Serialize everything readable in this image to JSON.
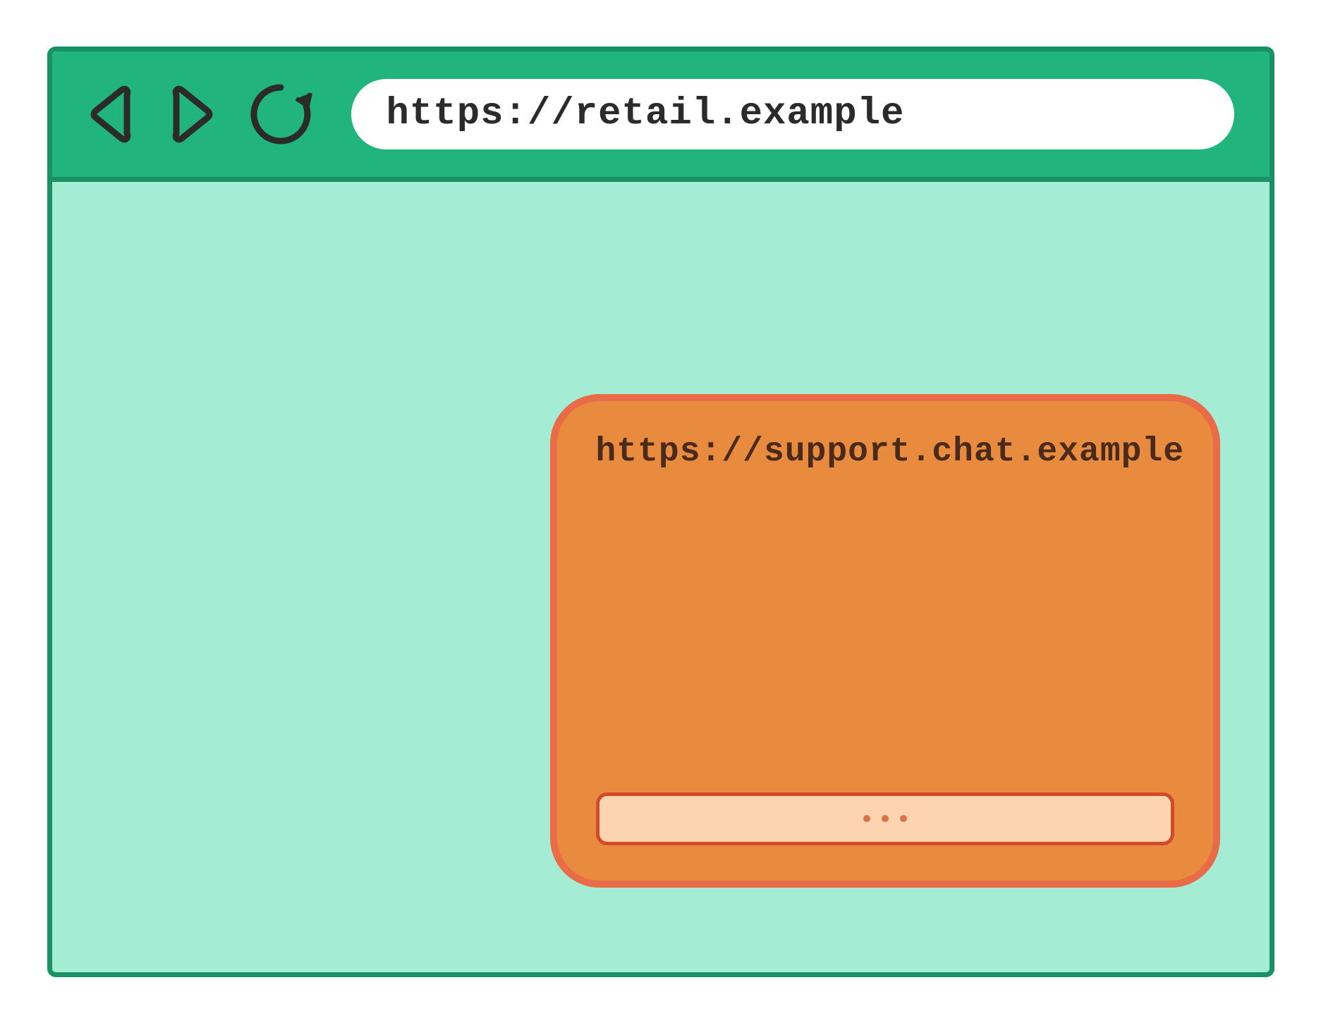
{
  "browser": {
    "url": "https://retail.example"
  },
  "chat_widget": {
    "url": "https://support.chat.example"
  },
  "colors": {
    "browser_border": "#1a9066",
    "toolbar_bg": "#21b47c",
    "content_bg": "#a4ecd4",
    "widget_bg": "#e98b3f",
    "widget_border": "#e96b47",
    "input_bg": "#fcd4b0",
    "input_border": "#d24a2a"
  }
}
